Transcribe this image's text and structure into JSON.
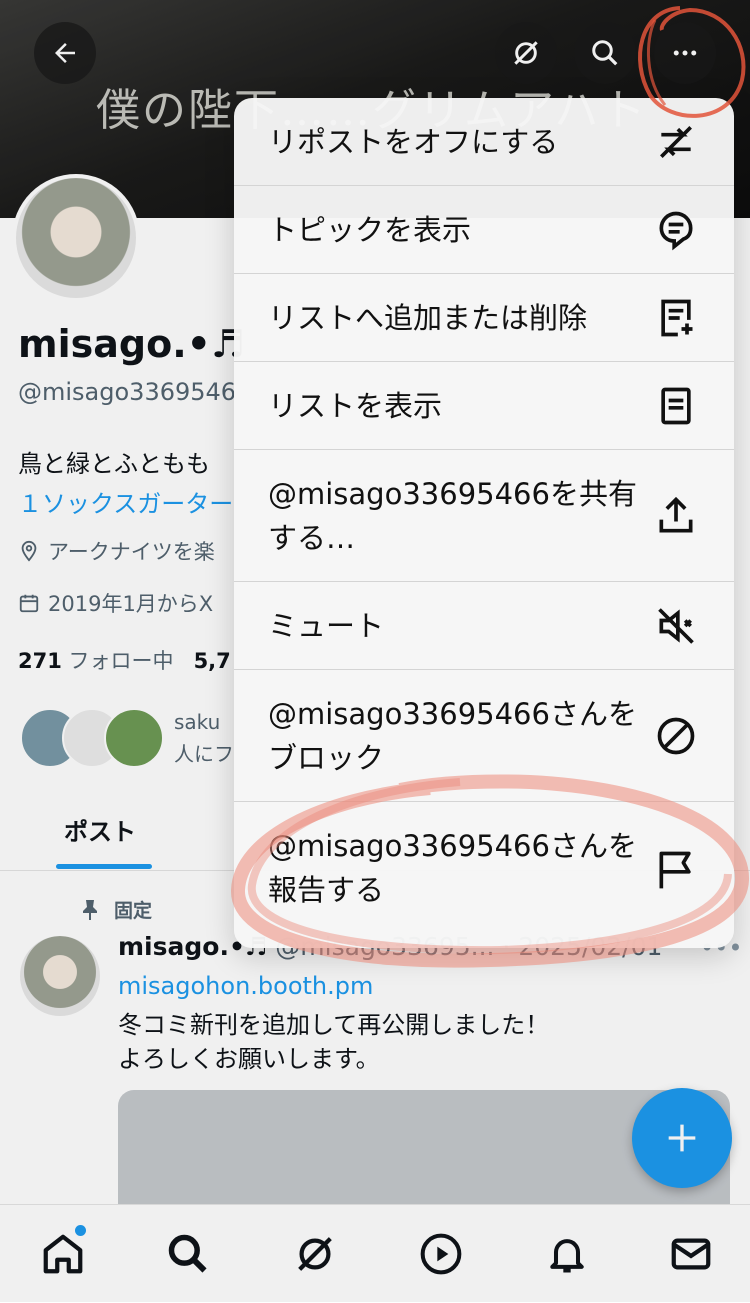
{
  "banner": {
    "text": "僕の陛下……グリムアハト"
  },
  "header": {
    "back_icon": "arrow-left-icon",
    "grok_icon": "grok-icon",
    "search_icon": "search-icon",
    "more_icon": "more-horizontal-icon"
  },
  "profile": {
    "name": "misago.•♬",
    "handle": "@misago3369546",
    "bio_line1": "鳥と緑とふともも",
    "bio_line2": "１ソックスガーター",
    "location": "アークナイツを楽",
    "joined": "2019年1月からX",
    "following_count": "271",
    "following_label": "フォロー中",
    "followers_count": "5,7",
    "followed_by_line1": "saku",
    "followed_by_line2": "人にフ"
  },
  "tabs": [
    {
      "label": "ポスト"
    }
  ],
  "post": {
    "pinned_label": "固定",
    "author": "misago.•♬",
    "handle_date": "@misago33695... · 2025/02/01",
    "more": "•••",
    "link": "misagohon.booth.pm",
    "text_line1": "冬コミ新刊を追加して再公開しました！",
    "text_line2": "よろしくお願いします。"
  },
  "menu": {
    "items": [
      {
        "label": "リポストをオフにする",
        "icon": "repost-off-icon"
      },
      {
        "label": "トピックを表示",
        "icon": "topic-icon"
      },
      {
        "label": "リストへ追加または削除",
        "icon": "list-add-icon"
      },
      {
        "label": "リストを表示",
        "icon": "list-icon"
      },
      {
        "label": "@misago33695466を共有する…",
        "icon": "share-icon"
      },
      {
        "label": "ミュート",
        "icon": "mute-icon"
      },
      {
        "label": "@misago33695466さんをブロック",
        "icon": "block-icon"
      },
      {
        "label": "@misago33695466さんを報告する",
        "icon": "flag-icon"
      }
    ]
  },
  "fab": {
    "icon": "plus-icon"
  },
  "bottom_nav": [
    {
      "icon": "home-icon",
      "has_dot": true
    },
    {
      "icon": "search-icon"
    },
    {
      "icon": "grok-icon"
    },
    {
      "icon": "play-icon"
    },
    {
      "icon": "bell-icon"
    },
    {
      "icon": "mail-icon"
    }
  ],
  "colors": {
    "accent": "#1d9bf0",
    "annotation": "#e2543a"
  }
}
